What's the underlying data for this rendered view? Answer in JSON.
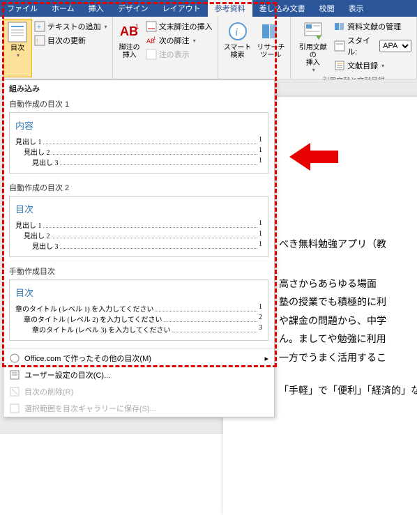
{
  "tabs": {
    "file": "ファイル",
    "home": "ホーム",
    "insert": "挿入",
    "design": "デザイン",
    "layout": "レイアウト",
    "references": "参考資料",
    "mailings": "差し込み文書",
    "review": "校閲",
    "view": "表示"
  },
  "ribbon": {
    "toc_group": {
      "toc_btn": "目次",
      "add_text": "テキストの追加",
      "update_toc": "目次の更新"
    },
    "footnote_group": {
      "insert_footnote": "脚注の\n挿入",
      "insert_endnote": "文末脚注の挿入",
      "next_footnote": "次の脚注",
      "show_notes": "注の表示"
    },
    "research_group": {
      "smart_lookup": "スマート\n検索",
      "research_tool": "リサーチ\nツール"
    },
    "citation_group": {
      "insert_citation": "引用文献の\n挿入",
      "manage_sources": "資料文献の管理",
      "style_label": "スタイル:",
      "style_value": "APA",
      "bibliography": "文献目録",
      "group_label": "引用文献と文献目録"
    }
  },
  "toc_dropdown": {
    "builtin_label": "組み込み",
    "auto1_title": "自動作成の目次 1",
    "auto1_heading": "内容",
    "auto2_title": "自動作成の目次 2",
    "auto2_heading": "目次",
    "manual_title": "手動作成目次",
    "manual_heading": "目次",
    "entries": {
      "h1": "見出し 1",
      "h2": "見出し 2",
      "h3": "見出し 3",
      "p1": "1",
      "p2": "1",
      "p3": "1"
    },
    "manual_entries": {
      "l1": "章のタイトル (レベル 1) を入力してください",
      "l2": "章のタイトル (レベル 2) を入力してください",
      "l3": "章のタイトル (レベル 3) を入力してください",
      "p1": "1",
      "p2": "2",
      "p3": "3"
    },
    "menu_office": "Office.com で作ったその他の目次(M)",
    "menu_custom": "ユーザー設定の目次(C)...",
    "menu_remove": "目次の削除(R)",
    "menu_save": "選択範囲を目次ギャラリーに保存(S)..."
  },
  "document": {
    "line1": "べき無料勉強アプリ（教",
    "line2": "高さからあらゆる場面",
    "line3": "塾の授業でも積極的に利",
    "line4": "や課金の問題から、中学",
    "line5": "ん。ましてや勉強に利用",
    "line6": "一方でうまく活用するこ",
    "line7": "「手軽」で「便利」「経済的」なアプリ"
  }
}
